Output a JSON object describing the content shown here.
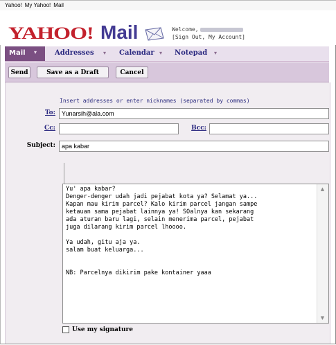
{
  "top_links": [
    "Yahoo!",
    "My Yahoo!",
    "Mail"
  ],
  "brand": {
    "logo_text": "YAHOO!",
    "product": "Mail"
  },
  "welcome": {
    "greeting": "Welcome,",
    "links": "[Sign Out, My Account]"
  },
  "tabs": {
    "mail": "Mail",
    "addresses": "Addresses",
    "calendar": "Calendar",
    "notepad": "Notepad",
    "dropdown_glyph": "▾"
  },
  "toolbar": {
    "send": "Send",
    "save_draft": "Save as a Draft",
    "cancel": "Cancel"
  },
  "compose": {
    "hint": "Insert addresses or enter nicknames (separated by commas)",
    "to_label": "To:",
    "to_value": "Yunarsih@ala.com",
    "cc_label": "Cc:",
    "cc_value": "",
    "bcc_label": "Bcc:",
    "bcc_value": "",
    "subject_label": "Subject:",
    "subject_value": "apa kabar",
    "message": "Yu' apa kabar?\nDenger-denger udah jadi pejabat kota ya? Selamat ya...\nKapan mau kirim parcel? Kalo kirim parcel jangan sampe\nketauan sama pejabat lainnya ya! SOalnya kan sekarang\nada aturan baru lagi, selain menerima parcel, pejabat\njuga dilarang kirim parcel lhoooo.\n\nYa udah, gitu aja ya.\nsalam buat keluarga...\n\n\nNB: Parcelnya dikirim pake kontainer yaaa",
    "signature_label": "Use my signature",
    "signature_checked": false
  },
  "colors": {
    "brand_red": "#c3212c",
    "brand_purple": "#433b93",
    "tab_active": "#7b4f82",
    "toolbar_bg": "#d8c7dc",
    "link_blue": "#2b2980"
  }
}
